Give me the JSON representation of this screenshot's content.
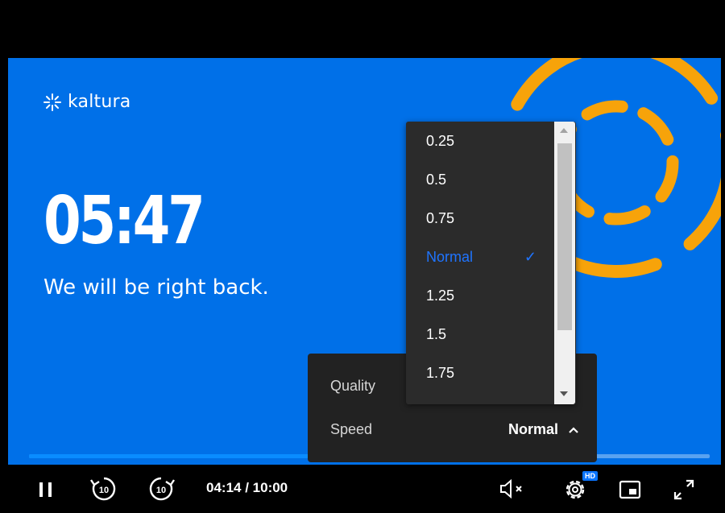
{
  "brand": {
    "name": "kaltura"
  },
  "slate": {
    "countdown": "05:47",
    "message": "We will be right back."
  },
  "playback": {
    "current_time": "04:14",
    "duration": "10:00",
    "time_separator": " / ",
    "progress_fraction": 0.423
  },
  "settings": {
    "quality_label": "Quality",
    "speed_label": "Speed",
    "speed_value": "Normal"
  },
  "speed_menu": {
    "options": [
      "0.25",
      "0.5",
      "0.75",
      "Normal",
      "1.25",
      "1.5",
      "1.75"
    ],
    "selected": "Normal"
  },
  "controls": {
    "rewind_seconds": "10",
    "forward_seconds": "10",
    "hd_badge": "HD"
  },
  "colors": {
    "video_background": "#0070e8",
    "accent_orange": "#f7a30a",
    "accent_blue": "#1f74ff"
  }
}
